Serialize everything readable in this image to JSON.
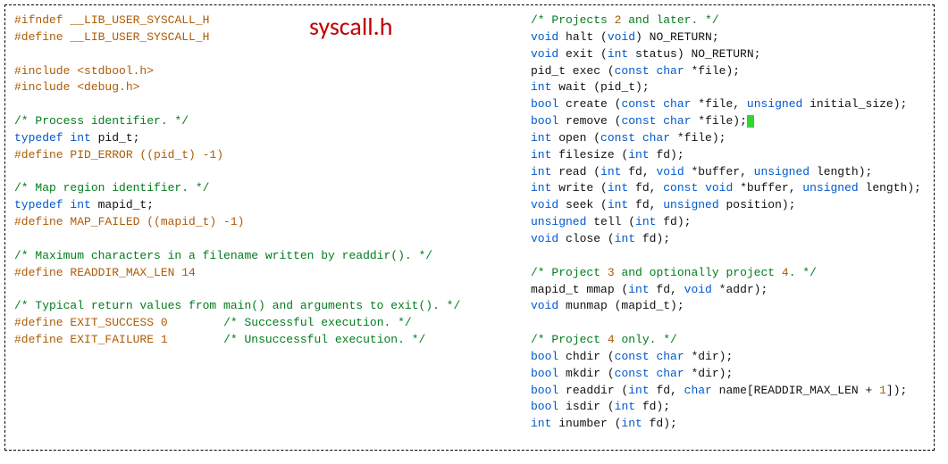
{
  "title": "syscall.h",
  "left": {
    "l01a": "#ifndef ",
    "l01b": "__LIB_USER_SYSCALL_H",
    "l02a": "#define ",
    "l02b": "__LIB_USER_SYSCALL_H",
    "blank": " ",
    "l04a": "#include ",
    "l04b": "<stdbool.h>",
    "l05a": "#include ",
    "l05b": "<debug.h>",
    "l07": "/* Process identifier. */",
    "l08a": "typedef",
    "l08b": " int",
    "l08c": " pid_t;",
    "l09a": "#define",
    "l09b": " PID_ERROR ((pid_t) -1)",
    "l11": "/* Map region identifier. */",
    "l12a": "typedef",
    "l12b": " int",
    "l12c": " mapid_t;",
    "l13a": "#define",
    "l13b": " MAP_FAILED ((mapid_t) -1)",
    "l15": "/* Maximum characters in a filename written by readdir(). */",
    "l16a": "#define",
    "l16b": " READDIR_MAX_LEN 14",
    "l18": "/* Typical return values from main() and arguments to exit(). */",
    "l19a": "#define",
    "l19b": " EXIT_SUCCESS 0",
    "l19c": "/* Successful execution. */",
    "l20a": "#define",
    "l20b": " EXIT_FAILURE 1",
    "l20c": "/* Unsuccessful execution. */"
  },
  "right": {
    "r01a": "/* Projects ",
    "r01b": "2",
    "r01c": " and later. */",
    "r02a": "void",
    "r02b": " halt (",
    "r02c": "void",
    "r02d": ") NO_RETURN;",
    "r03a": "void",
    "r03b": " exit (",
    "r03c": "int",
    "r03d": " status) NO_RETURN;",
    "r04a": "pid_t exec (",
    "r04b": "const",
    "r04c": " char",
    "r04d": " *file);",
    "r05a": "int",
    "r05b": " wait (pid_t);",
    "r06a": "bool",
    "r06b": " create (",
    "r06c": "const",
    "r06d": " char",
    "r06e": " *file, ",
    "r06f": "unsigned",
    "r06g": " initial_size);",
    "r07a": "bool",
    "r07b": " remove (",
    "r07c": "const",
    "r07d": " char",
    "r07e": " *file);",
    "r08a": "int",
    "r08b": " open (",
    "r08c": "const",
    "r08d": " char",
    "r08e": " *file);",
    "r09a": "int",
    "r09b": " filesize (",
    "r09c": "int",
    "r09d": " fd);",
    "r10a": "int",
    "r10b": " read (",
    "r10c": "int",
    "r10d": " fd, ",
    "r10e": "void",
    "r10f": " *buffer, ",
    "r10g": "unsigned",
    "r10h": " length);",
    "r11a": "int",
    "r11b": " write (",
    "r11c": "int",
    "r11d": " fd, ",
    "r11e": "const",
    "r11f": " void",
    "r11g": " *buffer, ",
    "r11h": "unsigned",
    "r11i": " length);",
    "r12a": "void",
    "r12b": " seek (",
    "r12c": "int",
    "r12d": " fd, ",
    "r12e": "unsigned",
    "r12f": " position);",
    "r13a": "unsigned",
    "r13b": " tell (",
    "r13c": "int",
    "r13d": " fd);",
    "r14a": "void",
    "r14b": " close (",
    "r14c": "int",
    "r14d": " fd);",
    "r16a": "/* Project ",
    "r16b": "3",
    "r16c": " and optionally project ",
    "r16d": "4",
    "r16e": ". */",
    "r17a": "mapid_t mmap (",
    "r17b": "int",
    "r17c": " fd, ",
    "r17d": "void",
    "r17e": " *addr);",
    "r18a": "void",
    "r18b": " munmap (mapid_t);",
    "r20a": "/* Project ",
    "r20b": "4",
    "r20c": " only. */",
    "r21a": "bool",
    "r21b": " chdir (",
    "r21c": "const",
    "r21d": " char",
    "r21e": " *dir);",
    "r22a": "bool",
    "r22b": " mkdir (",
    "r22c": "const",
    "r22d": " char",
    "r22e": " *dir);",
    "r23a": "bool",
    "r23b": " readdir (",
    "r23c": "int",
    "r23d": " fd, ",
    "r23e": "char",
    "r23f": " name[READDIR_MAX_LEN + ",
    "r23g": "1",
    "r23h": "]);",
    "r24a": "bool",
    "r24b": " isdir (",
    "r24c": "int",
    "r24d": " fd);",
    "r25a": "int",
    "r25b": " inumber (",
    "r25c": "int",
    "r25d": " fd);"
  }
}
